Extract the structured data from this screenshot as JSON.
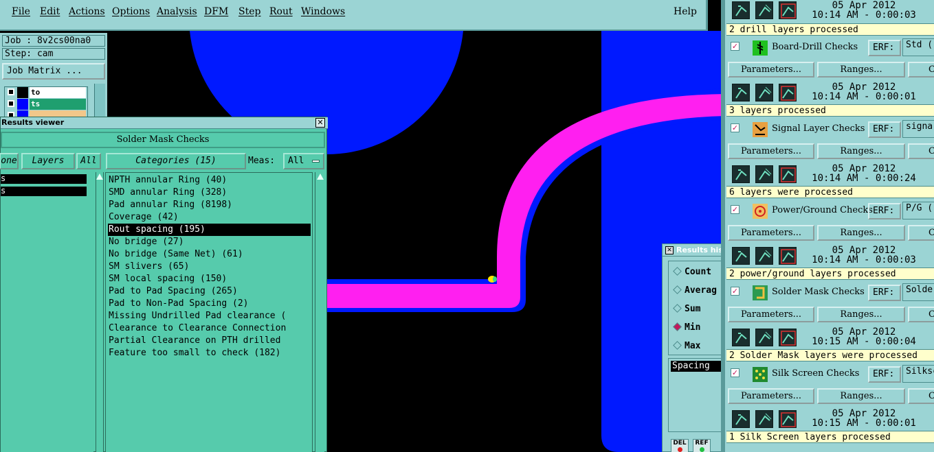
{
  "menubar": {
    "items": [
      "File",
      "Edit",
      "Actions",
      "Options",
      "Analysis",
      "DFM",
      "Step",
      "Rout",
      "Windows"
    ],
    "help": "Help"
  },
  "job": {
    "job_label": "Job : 8v2cs00na0",
    "step_label": "Step: cam",
    "matrix_button": "Job Matrix ...",
    "layers": [
      {
        "name": "to",
        "color": "#000000",
        "bg": "#ffffff"
      },
      {
        "name": "ts",
        "color": "#0000ff",
        "bg": "#1f9f6f"
      },
      {
        "name": "",
        "color": "#0000ff",
        "bg": "#f2c78a"
      }
    ]
  },
  "results_viewer": {
    "title": "Results viewer",
    "close": "✕",
    "header": "Solder Mask Checks",
    "tab_none": "one",
    "tab_layers": "Layers",
    "tab_all": "All",
    "tab_categories": "Categories (15)",
    "meas_label": "Meas:",
    "meas_value": "All",
    "layer_rows": [
      "s",
      "s"
    ],
    "categories": [
      "NPTH annular Ring (40)",
      "SMD annular Ring (328)",
      "Pad annular Ring (8198)",
      "Coverage (42)",
      "Rout spacing (195)",
      "No bridge (27)",
      "No bridge (Same Net) (61)",
      "SM slivers (65)",
      "SM local spacing (150)",
      "Pad to Pad Spacing (265)",
      "Pad to Non-Pad Spacing (2)",
      "Missing Undrilled Pad clearance (",
      "Clearance to Clearance Connection",
      "Partial Clearance on PTH drilled",
      "Feature too small to check (182)"
    ],
    "selected_index": 4
  },
  "results_hist": {
    "title": "Results his",
    "radios": [
      {
        "label": "Count",
        "on": false
      },
      {
        "label": "Averag",
        "on": false
      },
      {
        "label": "Sum",
        "on": false
      },
      {
        "label": "Min",
        "on": true
      },
      {
        "label": "Max",
        "on": false
      }
    ],
    "list_item": "Spacing",
    "btn_del": "DEL",
    "btn_ref": "REF"
  },
  "checks": {
    "top": {
      "date": "05 Apr 2012",
      "time": "10:14 AM - 0:00:03",
      "status": "2 drill layers processed"
    },
    "params_label": "Parameters...",
    "ranges_label": "Ranges...",
    "c_label": "C",
    "erf_label": "ERF:",
    "items": [
      {
        "name": "Board-Drill Checks",
        "erf": "Std (",
        "date": "05 Apr 2012",
        "time": "10:14 AM - 0:00:01",
        "status": "3 layers processed"
      },
      {
        "name": "Signal Layer Checks",
        "erf": "signa",
        "date": "05 Apr 2012",
        "time": "10:14 AM - 0:00:24",
        "status": "6 layers were processed"
      },
      {
        "name": "Power/Ground Checks",
        "erf": "P/G (",
        "date": "05 Apr 2012",
        "time": "10:14 AM - 0:00:03",
        "status": "2 power/ground layers processed"
      },
      {
        "name": "Solder Mask Checks",
        "erf": "Solder",
        "date": "05 Apr 2012",
        "time": "10:15 AM - 0:00:04",
        "status": "2 Solder Mask layers were processed"
      },
      {
        "name": "Silk Screen Checks",
        "erf": "Silksc",
        "date": "05 Apr 2012",
        "time": "10:15 AM - 0:00:01",
        "status": "1 Silk Screen layers processed"
      }
    ]
  },
  "colors": {
    "panel": "#9bd4d4",
    "viewer": "#56cbac",
    "pad_blue": "#0019ff",
    "trace_magenta": "#ff1ff0"
  }
}
